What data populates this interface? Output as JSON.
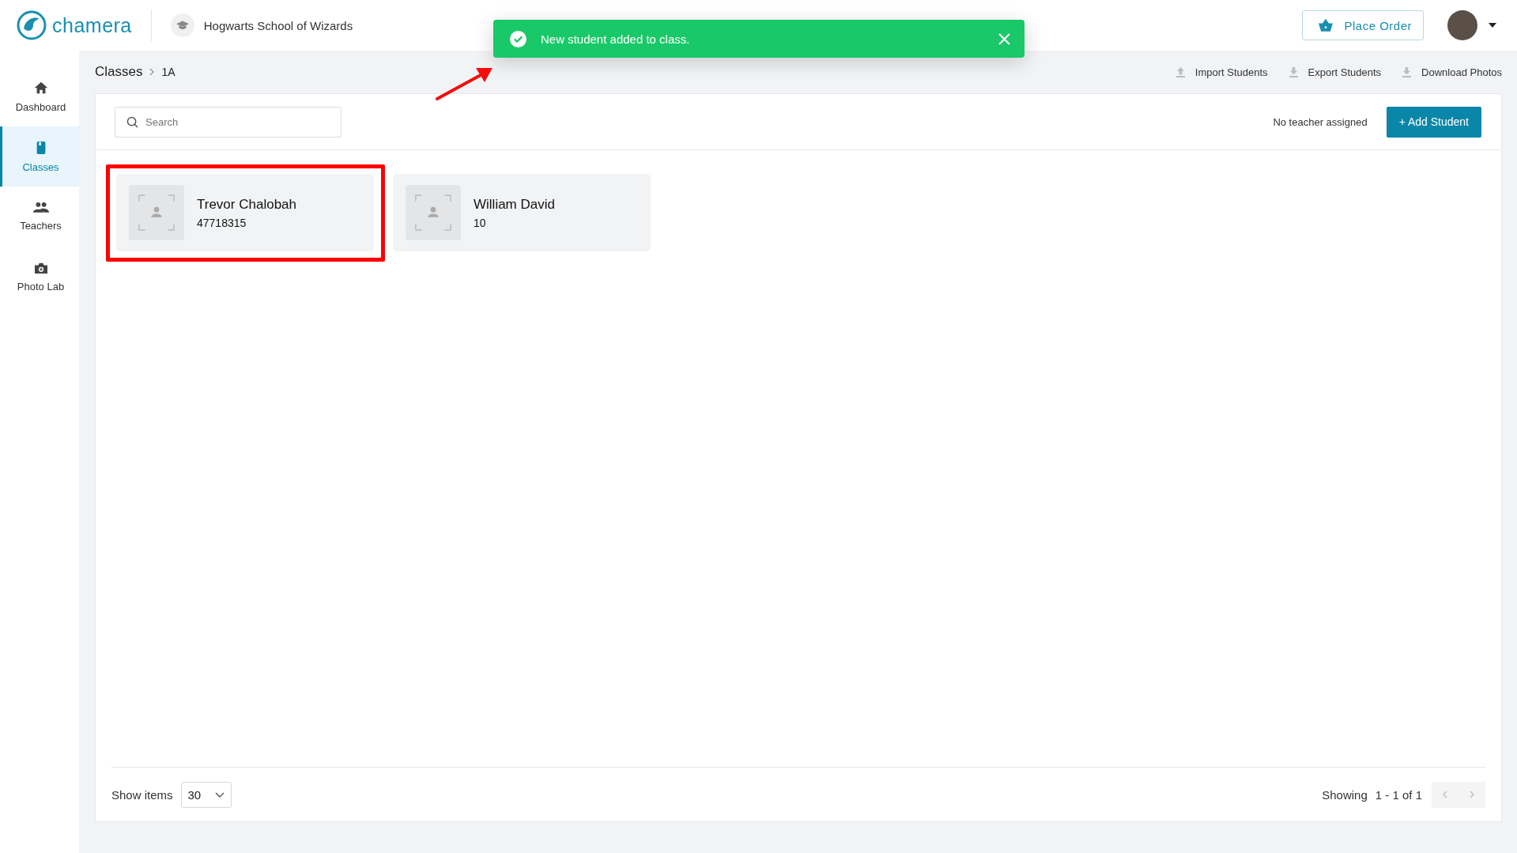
{
  "header": {
    "logo": "chamera",
    "school": "Hogwarts School of Wizards",
    "place_order": "Place Order"
  },
  "toast": {
    "kind": "success",
    "message": "New student added to class."
  },
  "sidebar": {
    "items": [
      {
        "label": "Dashboard",
        "kind": "home",
        "selected": false
      },
      {
        "label": "Classes",
        "kind": "book",
        "selected": true
      },
      {
        "label": "Teachers",
        "kind": "people",
        "selected": false
      },
      {
        "label": "Photo Lab",
        "kind": "camera",
        "selected": false
      }
    ]
  },
  "breadcrumb": [
    "Classes",
    "1A"
  ],
  "actions": [
    {
      "label": "Import Students",
      "kind": "upload"
    },
    {
      "label": "Export Students",
      "kind": "download"
    },
    {
      "label": "Download Photos",
      "kind": "download"
    }
  ],
  "search": {
    "placeholder": "Search"
  },
  "teacher_status": "No teacher assigned",
  "add_button": "+ Add Student",
  "students": [
    {
      "name": "Trevor Chalobah",
      "number": "47718315",
      "highlighted": true
    },
    {
      "name": "William David",
      "number": "10",
      "highlighted": false
    }
  ],
  "footer": {
    "show_items_label": "Show items",
    "page_size": "30",
    "showing_label": "Showing",
    "range": "1 - 1 of 1"
  }
}
